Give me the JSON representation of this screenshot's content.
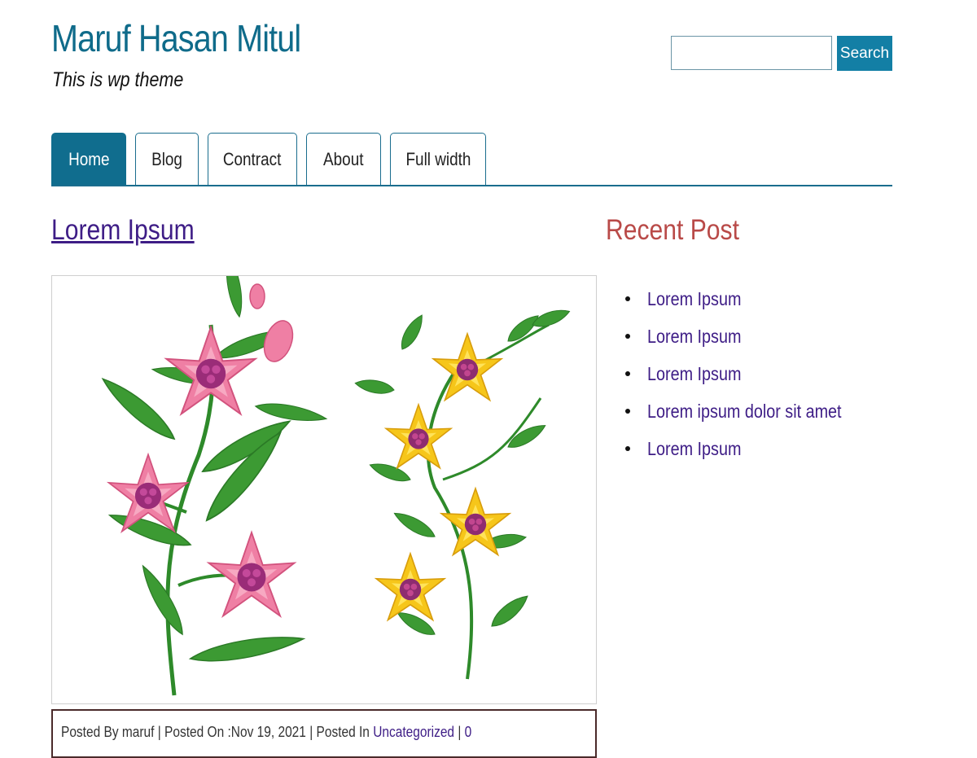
{
  "site": {
    "title": "Maruf Hasan Mitul",
    "tagline": "This is wp theme"
  },
  "search": {
    "value": "",
    "placeholder": "",
    "button_label": "Search"
  },
  "nav": {
    "tabs": [
      {
        "label": "Home",
        "active": true
      },
      {
        "label": "Blog",
        "active": false
      },
      {
        "label": "Contract",
        "active": false
      },
      {
        "label": "About",
        "active": false
      },
      {
        "label": "Full width",
        "active": false
      }
    ]
  },
  "post": {
    "title": "Lorem Ipsum",
    "image_icon": "flowers-illustration",
    "meta": {
      "posted_by_prefix": "Posted By ",
      "author": "maruf",
      "posted_on_prefix": " | Posted On :",
      "date": "Nov 19, 2021",
      "posted_in_prefix": " | Posted In ",
      "category": "Uncategorized",
      "separator": " | ",
      "comments": "0"
    }
  },
  "sidebar": {
    "title": "Recent Post",
    "items": [
      "Lorem Ipsum",
      "Lorem Ipsum",
      "Lorem Ipsum",
      "Lorem ipsum dolor sit amet",
      "Lorem Ipsum"
    ]
  },
  "colors": {
    "brand": "#0f6b8a",
    "nav_active": "#106d8e",
    "search_button": "#137fa5",
    "link": "#3e1d86",
    "sidebar_title": "#b94a48"
  }
}
